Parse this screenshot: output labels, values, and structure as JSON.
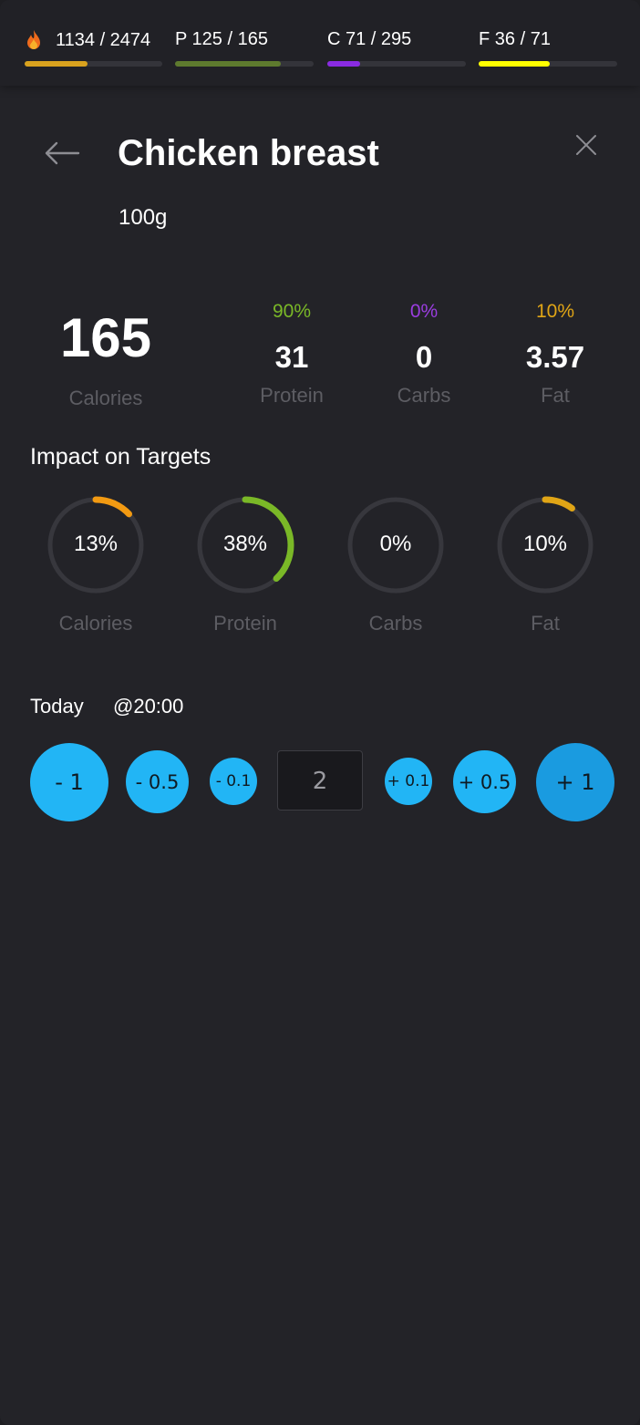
{
  "summary": {
    "calories": {
      "text": "1134 / 2474",
      "progress": 0.46,
      "color": "#d9a21e",
      "icon": "flame-icon"
    },
    "protein": {
      "text": "P 125 / 165",
      "progress": 0.76,
      "color": "#5e7a2e"
    },
    "carbs": {
      "text": "C 71 / 295",
      "progress": 0.24,
      "color": "#8a2be2"
    },
    "fat": {
      "text": "F 36 / 71",
      "progress": 0.51,
      "color": "#ffff00"
    }
  },
  "food": {
    "name": "Chicken breast",
    "serving": "100g"
  },
  "nutrition": {
    "calories": {
      "value": "165",
      "label": "Calories"
    },
    "protein": {
      "pct": "90%",
      "value": "31",
      "label": "Protein",
      "color": "#7ab827"
    },
    "carbs": {
      "pct": "0%",
      "value": "0",
      "label": "Carbs",
      "color": "#9b3de0"
    },
    "fat": {
      "pct": "10%",
      "value": "3.57",
      "label": "Fat",
      "color": "#e0a516"
    }
  },
  "impact": {
    "title": "Impact on Targets",
    "rings": [
      {
        "pct": "13%",
        "value": 0.13,
        "label": "Calories",
        "color": "#f29a12"
      },
      {
        "pct": "38%",
        "value": 0.38,
        "label": "Protein",
        "color": "#7ab827"
      },
      {
        "pct": "0%",
        "value": 0.0,
        "label": "Carbs",
        "color": "#9b3de0"
      },
      {
        "pct": "10%",
        "value": 0.1,
        "label": "Fat",
        "color": "#e0a516"
      }
    ]
  },
  "log": {
    "day": "Today",
    "time": "@20:00"
  },
  "quantity": {
    "value": "2",
    "buttons": {
      "minus1": "- 1",
      "minus05": "- 0.5",
      "minus01": "- 0.1",
      "plus01": "+ 0.1",
      "plus05": "+ 0.5",
      "plus1": "+ 1"
    }
  }
}
